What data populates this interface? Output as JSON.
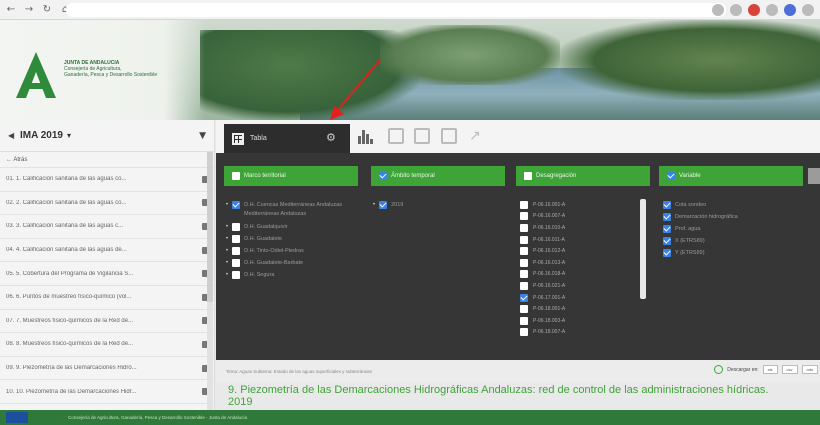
{
  "browser": {
    "url": "",
    "nav_icons": [
      "back-icon",
      "forward-icon",
      "reload-icon",
      "home-icon"
    ]
  },
  "banner": {
    "logo_line1": "JUNTA DE ANDALUCIA",
    "logo_line2": "Consejería de Agricultura,",
    "logo_line3": "Ganadería, Pesca y Desarrollo Sostenible"
  },
  "sidebar": {
    "title": "IMA 2019",
    "back_label": "Atrás",
    "items": [
      "01. 1. Calificación sanitaria de las aguas co...",
      "02. 2. Calificación sanitaria de las aguas co...",
      "03. 3. Calificación sanitaria de las aguas c...",
      "04. 4. Calificación sanitaria de las aguas de...",
      "05. 5. Cobertura del Programa de Vigilancia S...",
      "06. 6. Puntos de muestreo físico-químico (vol...",
      "07. 7. Muestreos físico-químicos de la Red de...",
      "08. 8. Muestreos físico-químicos de la Red de...",
      "09. 9. Piezometría de las Demarcaciones Hidro...",
      "10. 10. Piezometría de las Demarcaciones Hidr..."
    ]
  },
  "toolbar": {
    "active_tab": "Tabla"
  },
  "panel": {
    "columns": [
      {
        "label": "Marco territorial",
        "checked": false
      },
      {
        "label": "Ámbito temporal",
        "checked": true
      },
      {
        "label": "Desagregación",
        "checked": false
      },
      {
        "label": "Variable",
        "checked": true
      }
    ],
    "territory": [
      {
        "label": "D.H. Cuencas Mediterráneas Andaluzas",
        "checked": true,
        "label2": "Mediterráneas Andaluzas"
      },
      {
        "label": "D.H. Guadalquivir",
        "checked": false
      },
      {
        "label": "D.H. Guadalete",
        "checked": false
      },
      {
        "label": "D.H. Tinto-Odiel-Piedras",
        "checked": false
      },
      {
        "label": "D.H. Guadalete-Barbate",
        "checked": false
      },
      {
        "label": "D.H. Segura",
        "checked": false
      }
    ],
    "time": [
      {
        "label": "2019",
        "checked": true
      }
    ],
    "breakdown": [
      {
        "label": "P-06.16.001-A",
        "checked": false
      },
      {
        "label": "P-06.16.007-A",
        "checked": false
      },
      {
        "label": "P-06.16.010-A",
        "checked": false
      },
      {
        "label": "P-06.16.011-A",
        "checked": false
      },
      {
        "label": "P-06.16.012-A",
        "checked": false
      },
      {
        "label": "P-06.16.013-A",
        "checked": false
      },
      {
        "label": "P-06.16.018-A",
        "checked": false
      },
      {
        "label": "P-06.16.021-A",
        "checked": false
      },
      {
        "label": "P-06.17.001-A",
        "checked": true
      },
      {
        "label": "P-06.18.001-A",
        "checked": false
      },
      {
        "label": "P-06.18.003-A",
        "checked": false
      },
      {
        "label": "P-06.18.007-A",
        "checked": false
      }
    ],
    "variables": [
      {
        "label": "Cota sondeo",
        "checked": true
      },
      {
        "label": "Demarcación hidrográfica",
        "checked": true
      },
      {
        "label": "Prof. agua",
        "checked": true
      },
      {
        "label": "X (ETRS89)",
        "checked": true
      },
      {
        "label": "Y (ETRS89)",
        "checked": true
      }
    ]
  },
  "info": {
    "text": "Tema: Aguas Subtema: Estado de las aguas superficiales y subterráneas",
    "download_label": "Descargar en:",
    "formats": [
      "xls",
      "csv",
      "ods"
    ]
  },
  "title": {
    "line1": "9. Piezometría de las Demarcaciones Hidrográficas Andaluzas: red de control de las administraciones hídricas.",
    "line2": "2019"
  },
  "footer": {
    "text": "Consejería de Agricultura, Ganadería, Pesca y Desarrollo Sostenible - Junta de Andalucía"
  },
  "colors": {
    "green": "#3fa438",
    "dark_panel": "#363636",
    "checkbox_blue": "#3b82e6",
    "arrow_red": "#e3201b"
  }
}
